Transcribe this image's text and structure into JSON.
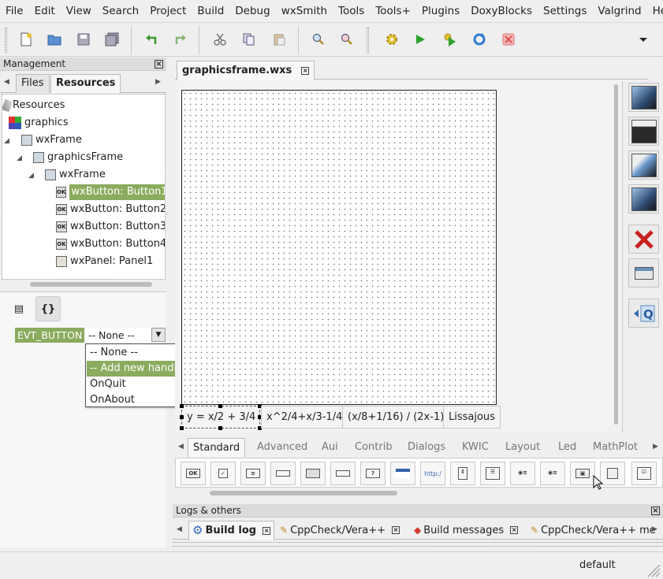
{
  "menubar": [
    "File",
    "Edit",
    "View",
    "Search",
    "Project",
    "Build",
    "Debug",
    "wxSmith",
    "Tools",
    "Tools+",
    "Plugins",
    "DoxyBlocks",
    "Settings",
    "Valgrind",
    "Help"
  ],
  "management": {
    "title": "Management",
    "tabs": [
      "Files",
      "Resources"
    ],
    "active_tab": "Resources",
    "tree": [
      {
        "label": "Resources",
        "icon": "resources-icon"
      },
      {
        "label": "graphics",
        "icon": "project-icon"
      },
      {
        "label": "wxFrame",
        "icon": "frame-icon"
      },
      {
        "label": "graphicsFrame",
        "icon": "frame-icon"
      },
      {
        "label": "wxFrame",
        "icon": "frame-icon"
      },
      {
        "label": "wxButton: Button1",
        "icon": "button-icon",
        "selected": true
      },
      {
        "label": "wxButton: Button2",
        "icon": "button-icon"
      },
      {
        "label": "wxButton: Button3",
        "icon": "button-icon"
      },
      {
        "label": "wxButton: Button4",
        "icon": "button-icon"
      },
      {
        "label": "wxPanel: Panel1",
        "icon": "panel-icon"
      }
    ]
  },
  "events": {
    "event_name": "EVT_BUTTON",
    "selected_handler": "-- None --",
    "options": [
      "-- None --",
      "-- Add new handler --",
      "OnQuit",
      "OnAbout"
    ],
    "highlighted": "-- Add new handler --"
  },
  "editor": {
    "tab_label": "graphicsframe.wxs",
    "buttons": [
      "y = x/2 + 3/4",
      "x^2/4+x/3-1/4",
      "(x/8+1/16) / (2x-1)",
      "Lissajous"
    ]
  },
  "palette": {
    "tabs": [
      "Standard",
      "Advanced",
      "Aui",
      "Contrib",
      "Dialogs",
      "KWIC",
      "Layout",
      "Led",
      "MathPlot"
    ],
    "active_tab": "Standard",
    "ok_text": "OK",
    "url_text": "http:/"
  },
  "logs": {
    "title": "Logs & others",
    "tabs": [
      "Build log",
      "CppCheck/Vera++",
      "Build messages",
      "CppCheck/Vera++ me"
    ],
    "active_tab": "Build log"
  },
  "status": {
    "text": "default"
  },
  "colors": {
    "selection": "#8bab5e"
  }
}
